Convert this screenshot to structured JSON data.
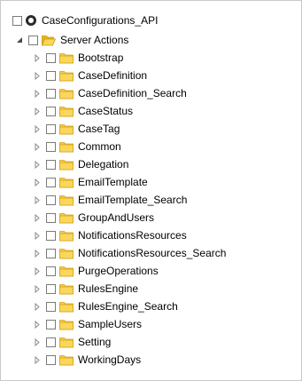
{
  "tree": {
    "root": {
      "label": "CaseConfigurations_API",
      "checked": false,
      "icon": "module-radio-icon"
    },
    "group": {
      "label": "Server Actions",
      "expanded": true,
      "icon": "folder-open-icon"
    },
    "items": [
      {
        "label": "Bootstrap"
      },
      {
        "label": "CaseDefinition"
      },
      {
        "label": "CaseDefinition_Search"
      },
      {
        "label": "CaseStatus"
      },
      {
        "label": "CaseTag"
      },
      {
        "label": "Common"
      },
      {
        "label": "Delegation"
      },
      {
        "label": "EmailTemplate"
      },
      {
        "label": "EmailTemplate_Search"
      },
      {
        "label": "GroupAndUsers"
      },
      {
        "label": "NotificationsResources"
      },
      {
        "label": "NotificationsResources_Search"
      },
      {
        "label": "PurgeOperations"
      },
      {
        "label": "RulesEngine"
      },
      {
        "label": "RulesEngine_Search"
      },
      {
        "label": "SampleUsers"
      },
      {
        "label": "Setting"
      },
      {
        "label": "WorkingDays"
      }
    ]
  },
  "colors": {
    "folder": "#f5c518",
    "folder_dark": "#d9a514",
    "checkbox_border": "#7a7a7a",
    "expander": "#8a8a8a"
  }
}
